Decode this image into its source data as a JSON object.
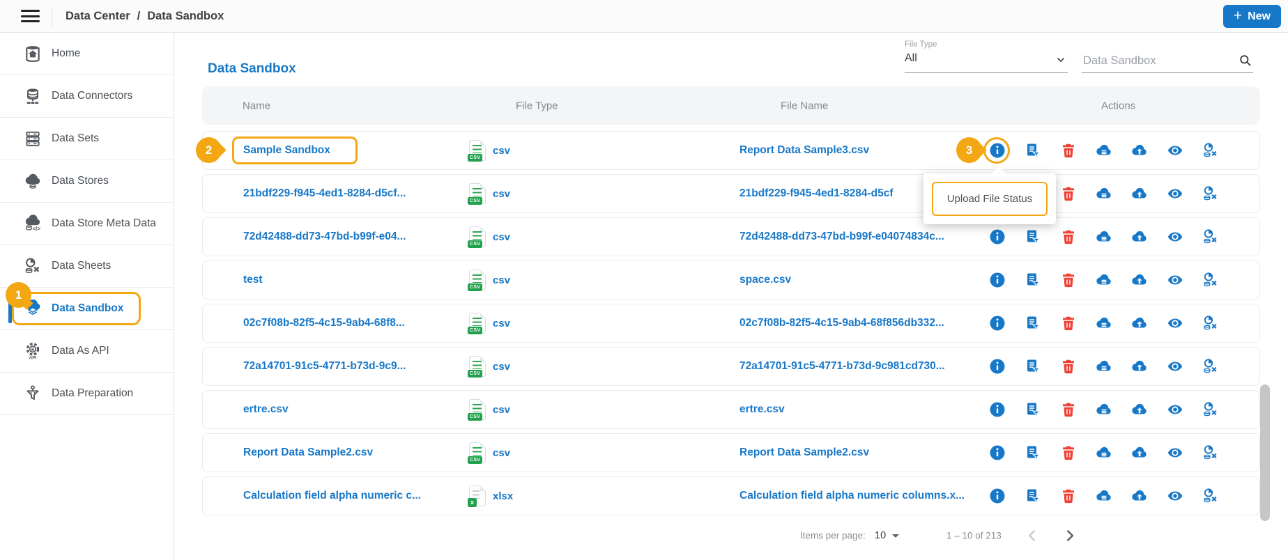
{
  "colors": {
    "primary": "#1878c8",
    "accent": "#f3a712",
    "danger": "#ef4136",
    "csv_green": "#21a14d"
  },
  "topbar": {
    "breadcrumb": {
      "items": [
        "Data Center",
        "Data Sandbox"
      ],
      "separator": "/"
    },
    "new_button": {
      "plus": "+",
      "label": "New"
    }
  },
  "sidebar": {
    "items": [
      {
        "label": "Home",
        "icon": "home"
      },
      {
        "label": "Data Connectors",
        "icon": "data-connectors"
      },
      {
        "label": "Data Sets",
        "icon": "data-sets"
      },
      {
        "label": "Data Stores",
        "icon": "data-stores"
      },
      {
        "label": "Data Store Meta Data",
        "icon": "data-store-meta-data"
      },
      {
        "label": "Data Sheets",
        "icon": "data-sheets"
      },
      {
        "label": "Data Sandbox",
        "icon": "data-sandbox",
        "active": true
      },
      {
        "label": "Data As API",
        "icon": "data-as-api"
      },
      {
        "label": "Data Preparation",
        "icon": "data-preparation"
      }
    ]
  },
  "main": {
    "title": "Data Sandbox",
    "filter": {
      "label": "File Type",
      "value": "All"
    },
    "search": {
      "placeholder": "Data Sandbox"
    },
    "table": {
      "headers": [
        "Name",
        "File Type",
        "File Name",
        "Actions"
      ],
      "action_icons": [
        "info-icon",
        "file-log-icon",
        "delete-icon",
        "data-store-icon",
        "upload-icon",
        "view-icon",
        "data-sheet-icon"
      ],
      "rows": [
        {
          "name": "Sample Sandbox",
          "file_type": "csv",
          "type_badge": "CSV",
          "file_name": "Report Data Sample3.csv",
          "highlighted": true
        },
        {
          "name": "21bdf229-f945-4ed1-8284-d5cf...",
          "file_type": "csv",
          "type_badge": "CSV",
          "file_name": "21bdf229-f945-4ed1-8284-d5cf"
        },
        {
          "name": "72d42488-dd73-47bd-b99f-e04...",
          "file_type": "csv",
          "type_badge": "CSV",
          "file_name": "72d42488-dd73-47bd-b99f-e04074834c..."
        },
        {
          "name": "test",
          "file_type": "csv",
          "type_badge": "CSV",
          "file_name": "space.csv"
        },
        {
          "name": "02c7f08b-82f5-4c15-9ab4-68f8...",
          "file_type": "csv",
          "type_badge": "CSV",
          "file_name": "02c7f08b-82f5-4c15-9ab4-68f856db332..."
        },
        {
          "name": "72a14701-91c5-4771-b73d-9c9...",
          "file_type": "csv",
          "type_badge": "CSV",
          "file_name": "72a14701-91c5-4771-b73d-9c981cd730..."
        },
        {
          "name": "ertre.csv",
          "file_type": "csv",
          "type_badge": "CSV",
          "file_name": "ertre.csv"
        },
        {
          "name": "Report Data Sample2.csv",
          "file_type": "csv",
          "type_badge": "CSV",
          "file_name": "Report Data Sample2.csv"
        },
        {
          "name": "Calculation field alpha numeric c...",
          "file_type": "xlsx",
          "type_badge": "x",
          "file_name": "Calculation field alpha numeric columns.x..."
        }
      ]
    },
    "tooltip": {
      "text": "Upload File Status"
    },
    "annotations": {
      "step1": "1",
      "step2": "2",
      "step3": "3"
    },
    "pagination": {
      "items_per_page_label": "Items per page:",
      "items_per_page_value": "10",
      "range_label": "1 – 10 of 213"
    }
  }
}
